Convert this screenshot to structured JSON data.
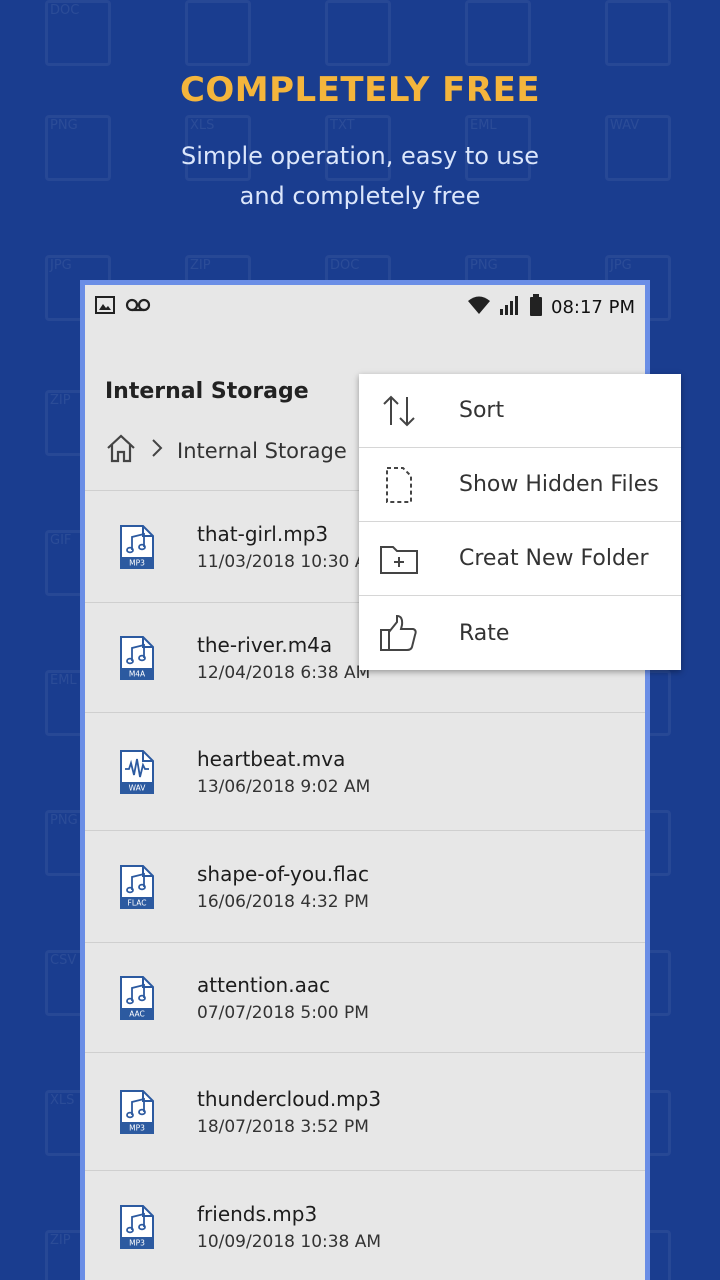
{
  "header": {
    "title": "COMPLETELY FREE",
    "subtitle_line1": "Simple operation, easy to use",
    "subtitle_line2": "and completely free"
  },
  "background_tiles": [
    "DOC",
    "CSV",
    "PPT",
    "GIF",
    "EXE",
    "PNG",
    "XLS",
    "TXT",
    "EML",
    "WAV",
    "JPG",
    "ZIP",
    "DOC",
    "PNG",
    "JPG",
    "ZIP",
    "DOC"
  ],
  "status_bar": {
    "time": "08:17 PM",
    "icons": [
      "image-icon",
      "voicemail-icon",
      "wifi-icon",
      "signal-icon",
      "battery-icon"
    ]
  },
  "app_bar": {
    "title": "Internal Storage"
  },
  "breadcrumb": {
    "home_icon": "home-icon",
    "separator_icon": "chevron-right-icon",
    "current": "Internal Storage"
  },
  "files": [
    {
      "name": "that-girl.mp3",
      "date": "11/03/2018 10:30 AM",
      "type": "MP3"
    },
    {
      "name": "the-river.m4a",
      "date": "12/04/2018 6:38 AM",
      "type": "M4A"
    },
    {
      "name": "heartbeat.mva",
      "date": "13/06/2018 9:02 AM",
      "type": "WAV"
    },
    {
      "name": "shape-of-you.flac",
      "date": "16/06/2018 4:32 PM",
      "type": "FLAC"
    },
    {
      "name": "attention.aac",
      "date": "07/07/2018 5:00 PM",
      "type": "AAC"
    },
    {
      "name": "thundercloud.mp3",
      "date": "18/07/2018 3:52 PM",
      "type": "MP3"
    },
    {
      "name": "friends.mp3",
      "date": "10/09/2018 10:38 AM",
      "type": "MP3"
    }
  ],
  "menu": {
    "items": [
      {
        "label": "Sort",
        "icon": "sort-arrows-icon"
      },
      {
        "label": "Show Hidden Files",
        "icon": "hidden-file-icon"
      },
      {
        "label": "Creat New Folder",
        "icon": "new-folder-icon"
      },
      {
        "label": "Rate",
        "icon": "thumbs-up-icon"
      }
    ]
  },
  "colors": {
    "background": "#1a3d8f",
    "accent_title": "#f4b53c",
    "phone_border": "#6a8ee6",
    "file_icon_blue": "#2c5aa0"
  }
}
